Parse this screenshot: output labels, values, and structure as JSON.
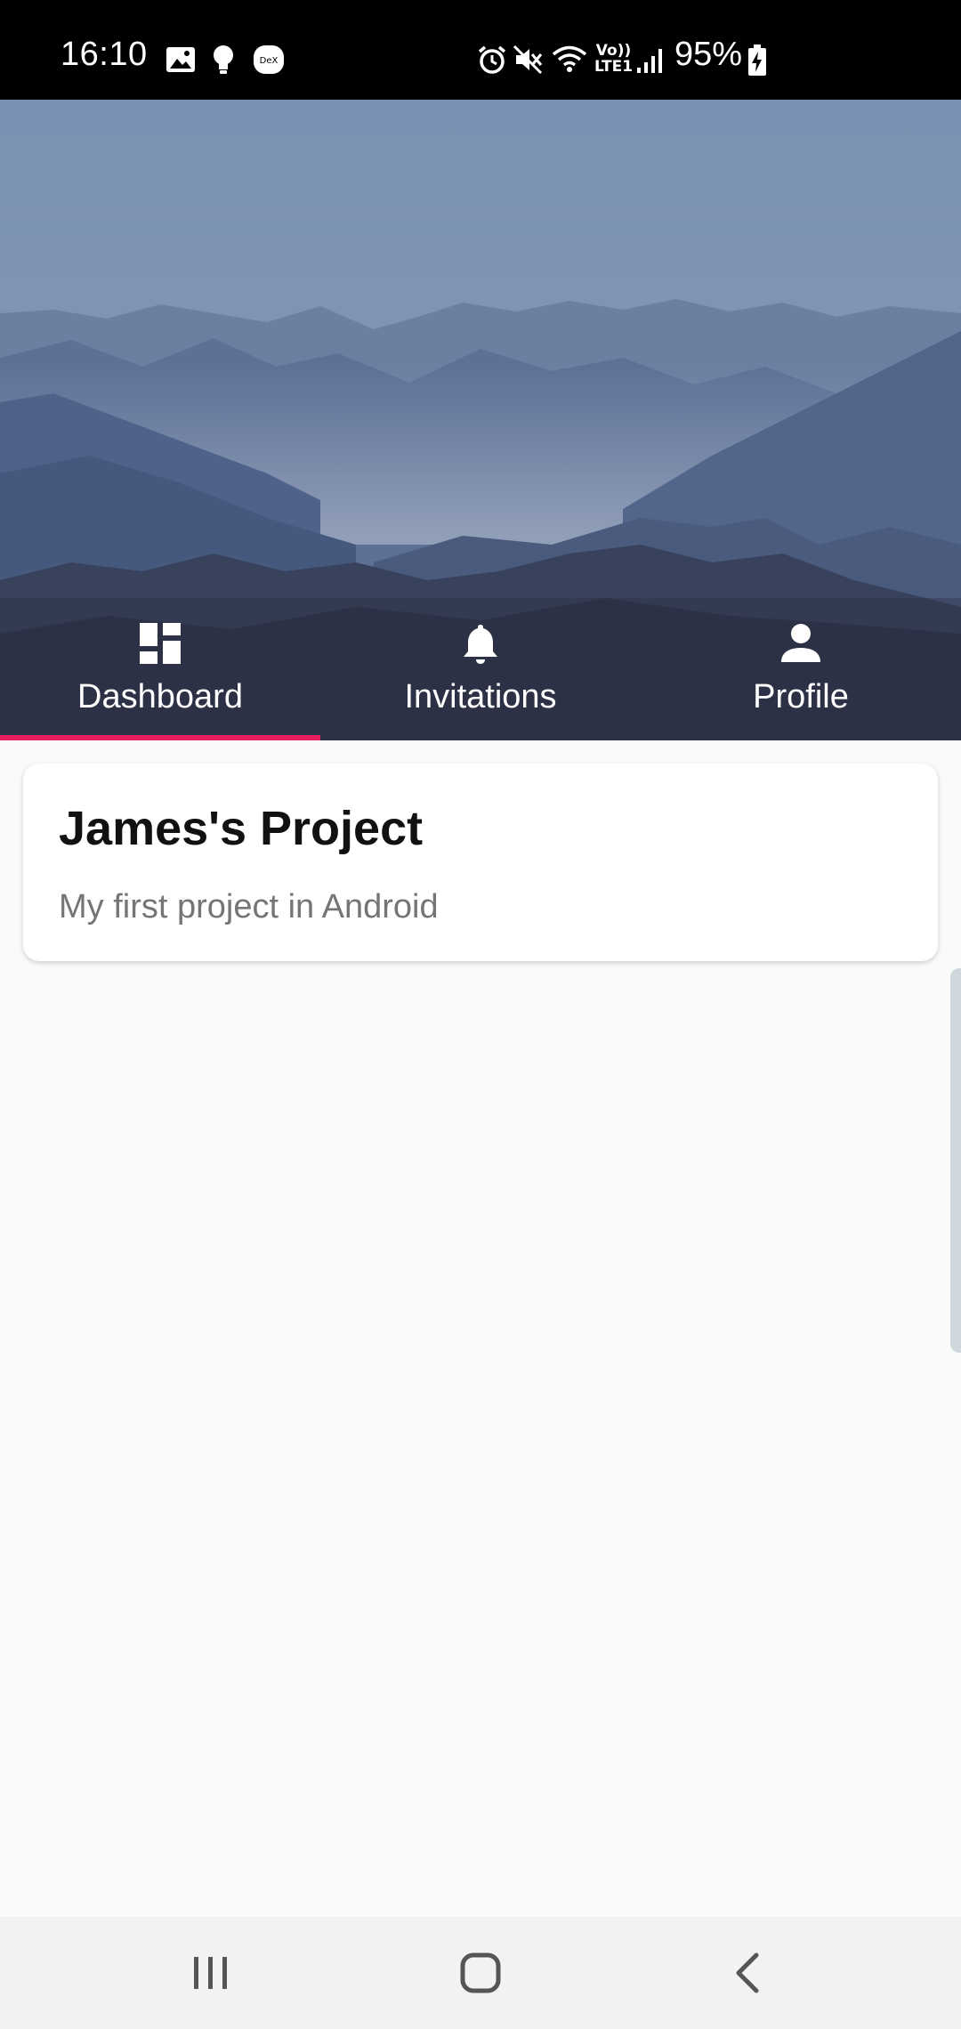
{
  "status_bar": {
    "time": "16:10",
    "battery": "95%",
    "network": [
      "Vo))",
      "LTE1"
    ],
    "icons": [
      "image-icon",
      "bulb-icon",
      "dex-icon",
      "alarm-icon",
      "mute-icon",
      "wifi-icon",
      "signal-icon",
      "battery-charging-icon"
    ]
  },
  "tabs": [
    {
      "label": "Dashboard",
      "icon": "dashboard-icon",
      "selected": true
    },
    {
      "label": "Invitations",
      "icon": "bell-icon",
      "selected": false
    },
    {
      "label": "Profile",
      "icon": "person-icon",
      "selected": false
    }
  ],
  "accent_color": "#e91e63",
  "projects": [
    {
      "title": "James's Project",
      "description": "My first project in Android"
    }
  ],
  "nav_bar": {
    "buttons": [
      "recents-icon",
      "home-icon",
      "back-icon"
    ]
  }
}
